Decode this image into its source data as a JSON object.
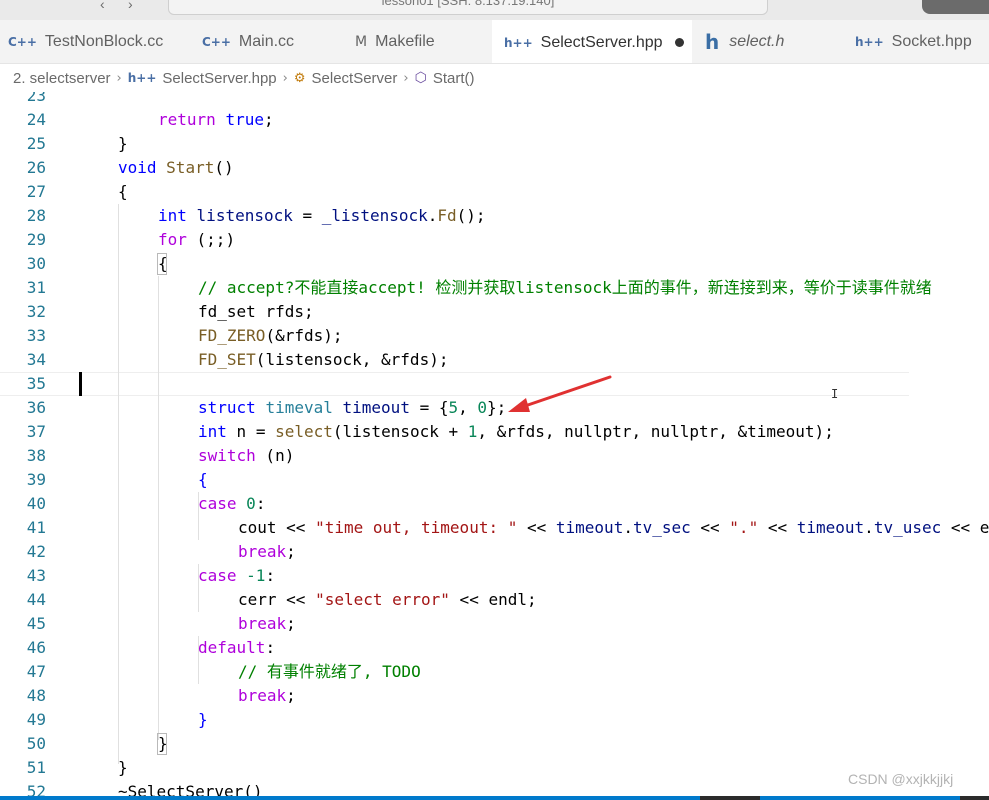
{
  "window": {
    "nav_back": "‹",
    "nav_forward": "›",
    "command_center": "lesson01 [SSH: 8.137.19.140]"
  },
  "tabs": [
    {
      "label": "TestNonBlock.cc",
      "icon": "C++",
      "active": false
    },
    {
      "label": "Main.cc",
      "icon": "C++",
      "active": false
    },
    {
      "label": "Makefile",
      "icon": "M",
      "active": false
    },
    {
      "label": "SelectServer.hpp",
      "icon": "h++",
      "active": true,
      "modified": true
    },
    {
      "label": "select.h",
      "icon": "h",
      "active": false,
      "italic": true
    },
    {
      "label": "Socket.hpp",
      "icon": "h++",
      "active": false
    }
  ],
  "breadcrumb": [
    {
      "label": "2. selectserver"
    },
    {
      "label": "SelectServer.hpp",
      "icon": "h++"
    },
    {
      "label": "SelectServer",
      "icon": "class"
    },
    {
      "label": "Start()",
      "icon": "method"
    }
  ],
  "editor": {
    "line_numbers": [
      "23",
      "24",
      "25",
      "26",
      "27",
      "28",
      "29",
      "30",
      "31",
      "32",
      "33",
      "34",
      "35",
      "36",
      "37",
      "38",
      "39",
      "40",
      "41",
      "42",
      "43",
      "44",
      "45",
      "46",
      "47",
      "48",
      "49",
      "50",
      "51",
      "52"
    ],
    "code": {
      "l23": "",
      "l24_kw": "return",
      "l24_val": "true",
      "l24_end": ";",
      "l25": "}",
      "l26_kw": "void",
      "l26_fn": "Start",
      "l26_paren": "()",
      "l27": "{",
      "l28_kw": "int",
      "l28_var": "listensock",
      "l28_eq": " = ",
      "l28_member": "_listensock",
      "l28_dot": ".",
      "l28_fn": "Fd",
      "l28_end": "();",
      "l29_kw": "for",
      "l29_rest": " (;;)",
      "l30": "{",
      "l31_comment": "// accept?不能直接accept! 检测并获取listensock上面的事件，新连接到来，等价于读事件就绪",
      "l32_type": "fd_set",
      "l32_var": "rfds",
      "l32_end": ";",
      "l33_macro": "FD_ZERO",
      "l33_args": "(&rfds);",
      "l34_macro": "FD_SET",
      "l34_open": "(",
      "l34_args": "listensock, &rfds);",
      "l36_kw": "struct",
      "l36_type": "timeval",
      "l36_var": "timeout",
      "l36_eq": " = {",
      "l36_n1": "5",
      "l36_sep": ", ",
      "l36_n2": "0",
      "l36_end": "};",
      "l37_kw": "int",
      "l37_var": "n",
      "l37_eq": " = ",
      "l37_fn": "select",
      "l37_open": "(",
      "l37_arg1": "listensock",
      "l37_plus": " + ",
      "l37_num": "1",
      "l37_rest": ", &rfds, nullptr, nullptr, &timeout);",
      "l38_kw": "switch",
      "l38_rest": " (n)",
      "l39": "{",
      "l40_kw": "case",
      "l40_num": "0",
      "l40_end": ":",
      "l41_var": "cout",
      "l41_op": " << ",
      "l41_str1": "\"time out, timeout: \"",
      "l41_member1": "timeout",
      "l41_field1": "tv_sec",
      "l41_str2": "\".\"",
      "l41_member2": "timeout",
      "l41_field2": "tv_usec",
      "l41_tail": " << e",
      "l42_kw": "break",
      "l42_end": ";",
      "l43_kw": "case",
      "l43_num": "-1",
      "l43_end": ":",
      "l44_var": "cerr",
      "l44_str": "\"select error\"",
      "l44_endl": "endl",
      "l44_end": ";",
      "l45_kw": "break",
      "l45_end": ";",
      "l46_kw": "default",
      "l46_end": ":",
      "l47_comment": "// 有事件就绪了, TODO",
      "l48_kw": "break",
      "l48_end": ";",
      "l49": "}",
      "l50": "}",
      "l51": "}",
      "l52": "~SelectServer()"
    }
  },
  "watermark": "CSDN @xxjkkjjkj",
  "colors": {
    "accent": "#007acc",
    "annotation_arrow": "#e03131"
  }
}
